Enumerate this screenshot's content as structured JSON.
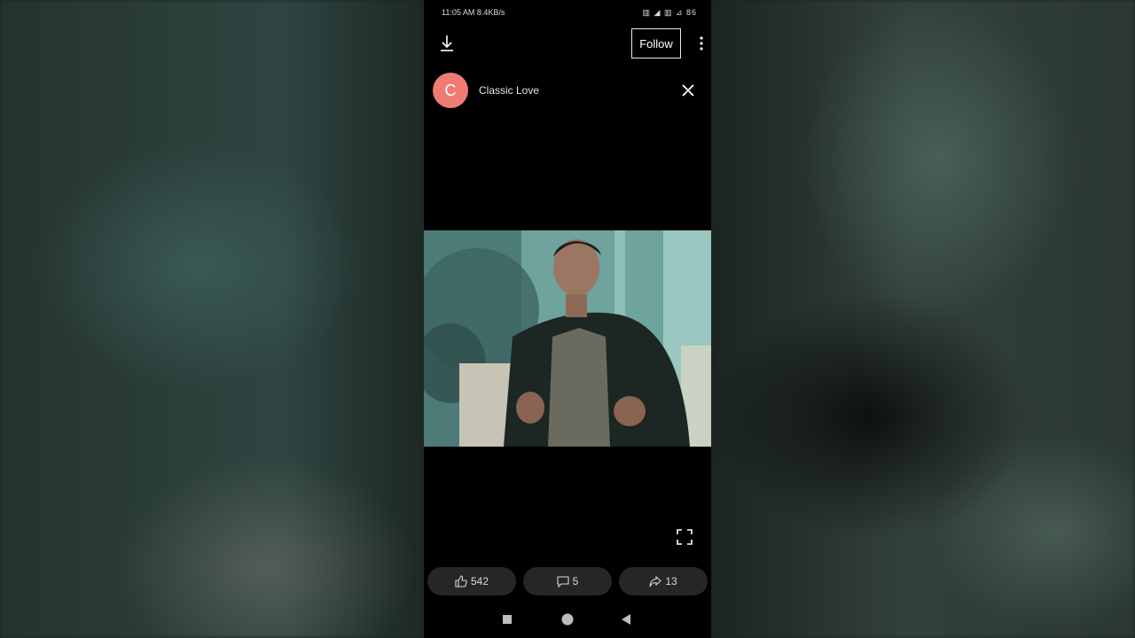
{
  "status_bar": {
    "time": "11:05 AM",
    "speed": "8.4KB/s",
    "right_text": "▥ ◢ ▥ ⊿ 86"
  },
  "header": {
    "follow_label": "Follow",
    "download_icon": "download-icon",
    "more_icon": "more-vertical-icon"
  },
  "channel": {
    "avatar_letter": "C",
    "name": "Classic Love",
    "avatar_color": "#ef7b72"
  },
  "actions": {
    "likes": "542",
    "comments": "5",
    "shares": "13"
  },
  "colors": {
    "background": "#000000",
    "pill": "#262626",
    "accent": "#ef7b72"
  }
}
